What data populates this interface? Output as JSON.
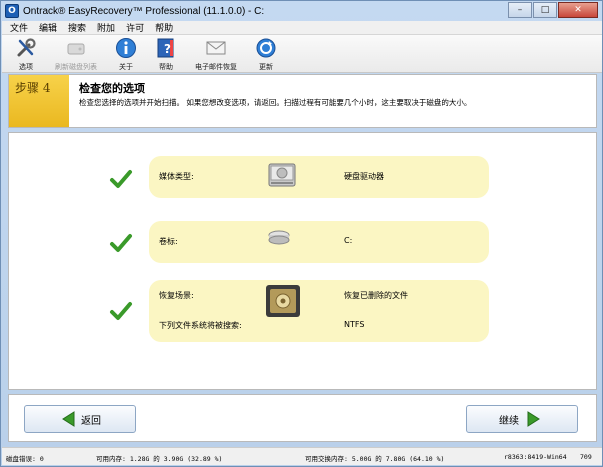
{
  "window": {
    "title": "Ontrack® EasyRecovery™ Professional (11.1.0.0) - C:",
    "buttons": {
      "minimize": "–",
      "maximize": "□",
      "close": "✕"
    }
  },
  "menu": [
    "文件",
    "编辑",
    "搜索",
    "附加",
    "许可",
    "帮助"
  ],
  "toolbar": [
    {
      "label": "选项",
      "icon": "tools-icon",
      "enabled": true
    },
    {
      "label": "刷新磁盘列表",
      "icon": "refresh-disk-icon",
      "enabled": false
    },
    {
      "label": "关于",
      "icon": "info-icon",
      "enabled": true
    },
    {
      "label": "帮助",
      "icon": "help-book-icon",
      "enabled": true
    },
    {
      "label": "电子邮件恢复",
      "icon": "envelope-icon",
      "enabled": true
    },
    {
      "label": "更新",
      "icon": "update-icon",
      "enabled": true
    }
  ],
  "step": {
    "label": "步骤 4",
    "title": "检查您的选项",
    "description": "检查您选择的选项并开始扫描。 如果您想改变选项，请返回。扫描过程有可能要几个小时，这主要取决于磁盘的大小。"
  },
  "summary": {
    "media_type_label": "媒体类型:",
    "media_type_value": "硬盘驱动器",
    "volume_label": "卷标:",
    "volume_value": "C:",
    "scenario_label": "恢复场景:",
    "scenario_value": "恢复已删除的文件",
    "filesystem_label": "下列文件系统将被搜索:",
    "filesystem_value": "NTFS"
  },
  "nav": {
    "back_label": "返回",
    "continue_label": "继续"
  },
  "status": {
    "disk_errors": "磁盘错误: 0",
    "memory": "可用内存: 1.28G 的 3.90G (32.89 %)",
    "swap": "可用交换内存: 5.00G 的 7.80G (64.10 %)",
    "build": "r8363:8419-Win64",
    "code": "709"
  },
  "colors": {
    "accent": "#3a9a2a",
    "step_badge": "#eab820",
    "row_bg": "#fbf6c3"
  }
}
